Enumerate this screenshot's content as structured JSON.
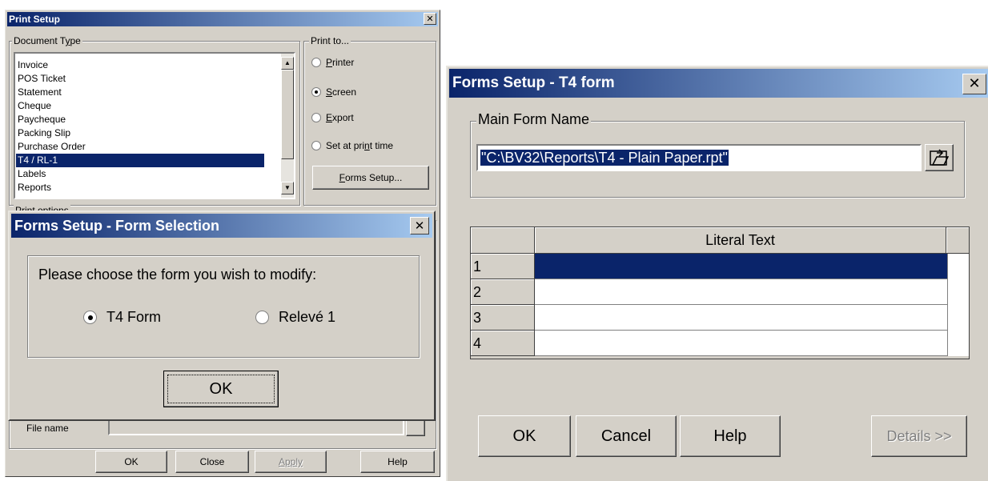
{
  "print_setup": {
    "title": "Print Setup",
    "document_type": {
      "label_pre": "Document T",
      "label_u": "y",
      "label_post": "pe",
      "items": [
        "Invoice",
        "POS Ticket",
        "Statement",
        "Cheque",
        "Paycheque",
        "Packing Slip",
        "Purchase Order",
        "T4 / RL-1",
        "Labels",
        "Reports"
      ],
      "selected": "T4 / RL-1"
    },
    "print_to": {
      "label": "Print to...",
      "printer": {
        "u": "P",
        "rest": "rinter"
      },
      "screen": {
        "u": "S",
        "rest": "creen"
      },
      "export": {
        "u": "E",
        "rest": "xport"
      },
      "set_at_print": {
        "pre": "Set at pri",
        "u": "n",
        "post": "t time"
      },
      "selected": "Screen"
    },
    "forms_setup_button": {
      "u": "F",
      "rest": "orms Setup..."
    },
    "partial_group_label": "Print options",
    "file_name_label": "File name",
    "buttons": {
      "ok": "OK",
      "close": "Close",
      "apply": "Apply",
      "help": "Help"
    }
  },
  "form_selection": {
    "title": "Forms Setup - Form Selection",
    "prompt": "Please choose the form you wish to modify:",
    "options": {
      "t4": "T4 Form",
      "releve": "Relevé 1"
    },
    "selected": "T4 Form",
    "ok": "OK"
  },
  "forms_setup_t4": {
    "title": "Forms Setup - T4 form",
    "main_form_name_label": "Main Form Name",
    "main_form_name_value": "\"C:\\BV32\\Reports\\T4 - Plain Paper.rpt\"",
    "grid": {
      "column_header": "Literal Text",
      "rows": [
        {
          "num": "1",
          "text": ""
        },
        {
          "num": "2",
          "text": ""
        },
        {
          "num": "3",
          "text": ""
        },
        {
          "num": "4",
          "text": ""
        }
      ],
      "selected_row": "1"
    },
    "buttons": {
      "ok": "OK",
      "cancel": "Cancel",
      "help": "Help",
      "details": "Details >>"
    }
  }
}
